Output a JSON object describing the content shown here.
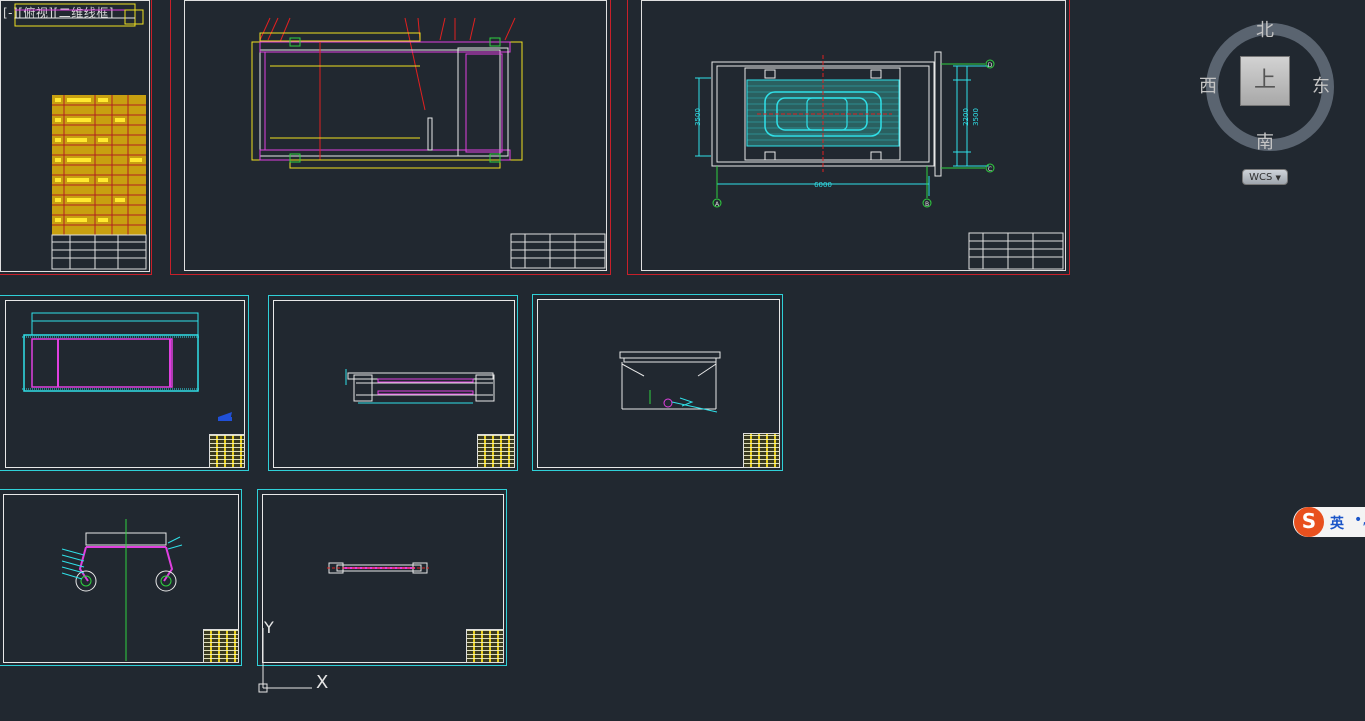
{
  "viewport": {
    "label": "[-][俯视][二维线框]"
  },
  "viewcube": {
    "north": "北",
    "south": "南",
    "east": "东",
    "west": "西",
    "top_face": "上",
    "wcs_label": "WCS"
  },
  "ime": {
    "logo": "S",
    "language": "英",
    "punct": "•,"
  },
  "ucs": {
    "x_label": "X",
    "y_label": "Y"
  },
  "dimensions": {
    "plan_width": "6000",
    "plan_height_left": "3500",
    "plan_height_right_total": "3500",
    "plan_height_right_mid": "2200",
    "grid_bubble_a": "A",
    "grid_bubble_b": "B",
    "grid_bubble_c": "C",
    "grid_bubble_d": "D"
  },
  "colors": {
    "background": "#212830",
    "sheet_red": "#c8202a",
    "sheet_cyan": "#2fd0d8",
    "yellow": "#f0e020",
    "magenta": "#e040e0",
    "cyan": "#30e0e8",
    "green": "#30d040",
    "red": "#e02020"
  }
}
